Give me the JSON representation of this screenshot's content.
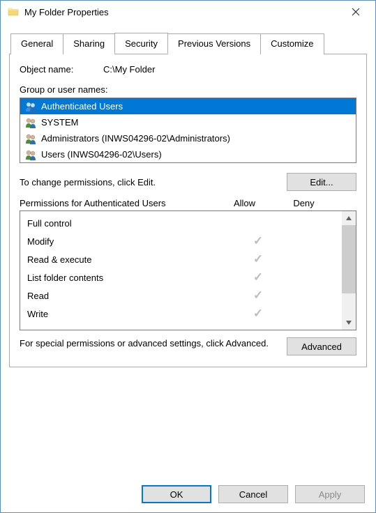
{
  "window": {
    "title": "My Folder Properties"
  },
  "tabs": {
    "general": "General",
    "sharing": "Sharing",
    "security": "Security",
    "previous": "Previous Versions",
    "customize": "Customize"
  },
  "object_name_label": "Object name:",
  "object_name_value": "C:\\My Folder",
  "group_label": "Group or user names:",
  "principals": [
    {
      "label": "Authenticated Users",
      "selected": true
    },
    {
      "label": "SYSTEM",
      "selected": false
    },
    {
      "label": "Administrators (INWS04296-02\\Administrators)",
      "selected": false
    },
    {
      "label": "Users (INWS04296-02\\Users)",
      "selected": false
    }
  ],
  "edit_hint": "To change permissions, click Edit.",
  "edit_button": "Edit...",
  "perm_title": "Permissions for Authenticated Users",
  "col_allow": "Allow",
  "col_deny": "Deny",
  "permissions": [
    {
      "name": "Full control",
      "allow": false,
      "deny": false
    },
    {
      "name": "Modify",
      "allow": true,
      "deny": false
    },
    {
      "name": "Read & execute",
      "allow": true,
      "deny": false
    },
    {
      "name": "List folder contents",
      "allow": true,
      "deny": false
    },
    {
      "name": "Read",
      "allow": true,
      "deny": false
    },
    {
      "name": "Write",
      "allow": true,
      "deny": false
    }
  ],
  "adv_hint": "For special permissions or advanced settings, click Advanced.",
  "adv_button": "Advanced",
  "buttons": {
    "ok": "OK",
    "cancel": "Cancel",
    "apply": "Apply"
  }
}
